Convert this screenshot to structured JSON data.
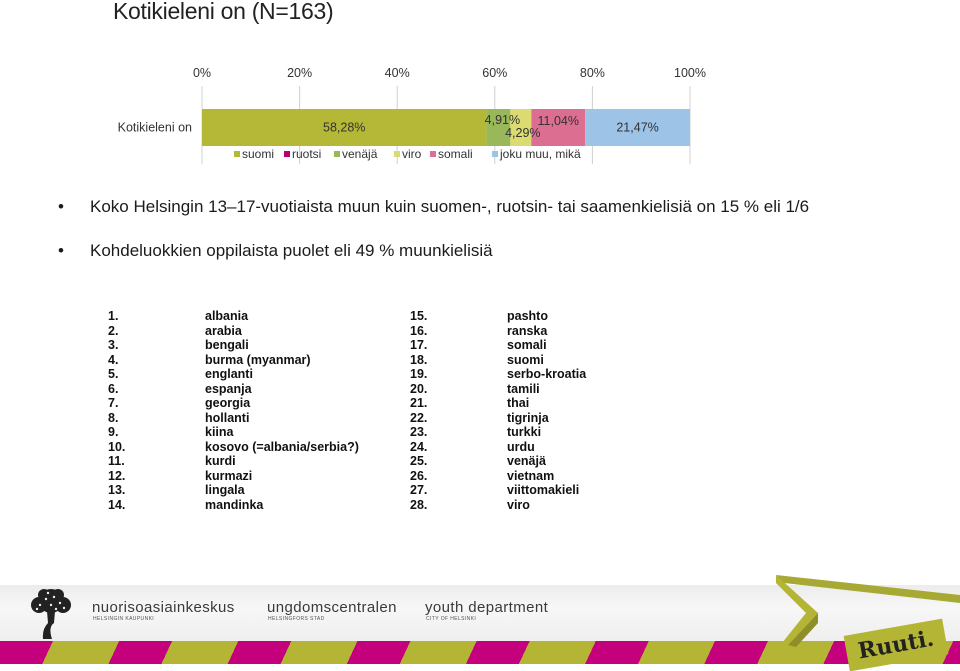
{
  "slide": {
    "title": "Kotikieleni on (N=163)"
  },
  "chart_data": {
    "type": "bar",
    "orientation": "horizontal",
    "stacked": "100%",
    "title": "",
    "categories": [
      "Kotikieleni on"
    ],
    "series": [
      {
        "name": "suomi",
        "values": [
          58.28
        ],
        "label": "58,28%",
        "color": "#b5b836"
      },
      {
        "name": "ruotsi",
        "values": [
          0
        ],
        "label": "",
        "color": "#b8006e"
      },
      {
        "name": "venäjä",
        "values": [
          4.91
        ],
        "label": "4,91%",
        "color": "#98b85a"
      },
      {
        "name": "viro",
        "values": [
          4.29
        ],
        "label": "4,29%",
        "color": "#dcdb72"
      },
      {
        "name": "somali",
        "values": [
          11.04
        ],
        "label": "11,04%",
        "color": "#dc6e92"
      },
      {
        "name": "joku muu, mikä",
        "values": [
          21.47
        ],
        "label": "21,47%",
        "color": "#9dc3e6"
      }
    ],
    "xlim": [
      0,
      100
    ],
    "xticks": [
      "0%",
      "20%",
      "40%",
      "60%",
      "80%",
      "100%"
    ],
    "xlabel": "",
    "ylabel": "",
    "grid": true,
    "legend": "bottom"
  },
  "bullets": [
    "Koko Helsingin 13–17-vuotiaista muun kuin suomen-, ruotsin- tai saamenkielisiä on 15 % eli 1/6",
    "Kohdeluokkien oppilaista puolet eli 49 % muunkielisiä"
  ],
  "bullet_glyph": "•",
  "languages": [
    {
      "num": "1.",
      "name": "albania"
    },
    {
      "num": "2.",
      "name": "arabia"
    },
    {
      "num": "3.",
      "name": "bengali"
    },
    {
      "num": "4.",
      "name": "burma (myanmar)"
    },
    {
      "num": "5.",
      "name": "englanti"
    },
    {
      "num": "6.",
      "name": "espanja"
    },
    {
      "num": "7.",
      "name": "georgia"
    },
    {
      "num": "8.",
      "name": "hollanti"
    },
    {
      "num": "9.",
      "name": "kiina"
    },
    {
      "num": "10.",
      "name": "kosovo (=albania/serbia?)"
    },
    {
      "num": "11.",
      "name": "kurdi"
    },
    {
      "num": "12.",
      "name": "kurmazi"
    },
    {
      "num": "13.",
      "name": "lingala"
    },
    {
      "num": "14.",
      "name": "mandinka"
    },
    {
      "num": "15.",
      "name": "pashto"
    },
    {
      "num": "16.",
      "name": "ranska"
    },
    {
      "num": "17.",
      "name": "somali"
    },
    {
      "num": "18.",
      "name": "suomi"
    },
    {
      "num": "19.",
      "name": "serbo-kroatia"
    },
    {
      "num": "20.",
      "name": "tamili"
    },
    {
      "num": "21.",
      "name": "thai"
    },
    {
      "num": "22.",
      "name": "tigrinja"
    },
    {
      "num": "23.",
      "name": "turkki"
    },
    {
      "num": "24.",
      "name": "urdu"
    },
    {
      "num": "25.",
      "name": "venäjä"
    },
    {
      "num": "26.",
      "name": "vietnam"
    },
    {
      "num": "27.",
      "name": "viittomakieli"
    },
    {
      "num": "28.",
      "name": "viro"
    }
  ],
  "footer": {
    "logos": [
      {
        "name": "nuorisoasiainkeskus",
        "sub": "HELSINGIN KAUPUNKI"
      },
      {
        "name": "ungdomscentralen",
        "sub": "HELSINGFORS STAD"
      },
      {
        "name": "youth department",
        "sub": "CITY OF HELSINKI"
      }
    ],
    "brand": "Ruuti.",
    "colors": {
      "magenta": "#c5007c",
      "olive": "#b4b534"
    }
  }
}
